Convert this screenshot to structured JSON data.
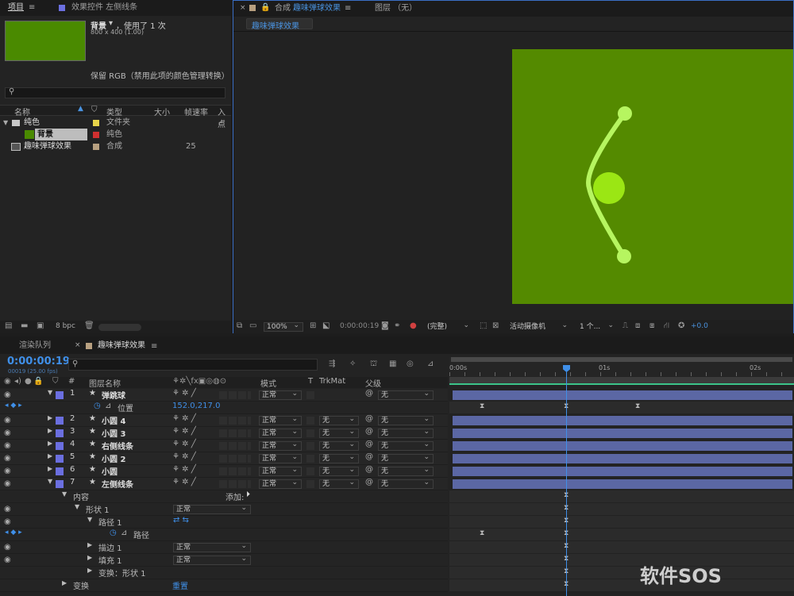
{
  "project_panel": {
    "tab_project": "项目",
    "tab_effects": "效果控件 左侧线条",
    "item_name": "背景",
    "item_usage": "，使用了 1 次",
    "item_dims": "800 x 400 (1.00)",
    "color_note": "保留 RGB（禁用此项的颜色管理转换）",
    "search_placeholder": "",
    "columns": [
      "名称",
      "类型",
      "大小",
      "帧速率",
      "入点"
    ],
    "rows": [
      {
        "name": "纯色",
        "type": "文件夹",
        "size": "",
        "fps": "",
        "color": "#e8d44a"
      },
      {
        "name": "背景",
        "type": "纯色",
        "size": "",
        "fps": "",
        "color": "#d03030"
      },
      {
        "name": "趣味弹球效果",
        "type": "合成",
        "size": "",
        "fps": "25",
        "color": "#b8a080"
      }
    ],
    "bpc": "8 bpc",
    "swatch_color": "#4a8a00"
  },
  "comp_panel": {
    "tab_comp_prefix": "合成",
    "tab_comp": "趣味弹球效果",
    "tab_layer": "图层 （无）",
    "comp_tab_label": "趣味弹球效果",
    "bg_color": "#548a00",
    "zoom": "100%",
    "timecode": "0:00:00:19",
    "quality": "(完整)",
    "camera": "活动摄像机",
    "views": "1 个...",
    "exposure": "+0.0"
  },
  "timeline": {
    "tab_render": "渲染队列",
    "tab_comp": "趣味弹球效果",
    "timecode": "0:00:00:19",
    "fps_info": "00019 (25.00 fps)",
    "col_hash": "#",
    "col_layer_name": "图层名称",
    "col_mode": "模式",
    "col_t": "T",
    "col_trkmat": "TrkMat",
    "col_parent": "父级",
    "ruler": [
      "0:00s",
      "01s",
      "02s"
    ],
    "layers": [
      {
        "num": "1",
        "name": "弹跳球",
        "mode": "正常",
        "trkmat": "",
        "parent": "无"
      },
      {
        "num": "2",
        "name": "小圆 4",
        "mode": "正常",
        "trkmat": "无",
        "parent": "无"
      },
      {
        "num": "3",
        "name": "小圆 3",
        "mode": "正常",
        "trkmat": "无",
        "parent": "无"
      },
      {
        "num": "4",
        "name": "右侧线条",
        "mode": "正常",
        "trkmat": "无",
        "parent": "无"
      },
      {
        "num": "5",
        "name": "小圆 2",
        "mode": "正常",
        "trkmat": "无",
        "parent": "无"
      },
      {
        "num": "6",
        "name": "小圆",
        "mode": "正常",
        "trkmat": "无",
        "parent": "无"
      },
      {
        "num": "7",
        "name": "左侧线条",
        "mode": "正常",
        "trkmat": "无",
        "parent": "无"
      }
    ],
    "position_label": "位置",
    "position_value": "152.0,217.0",
    "contents_label": "内容",
    "add_label": "添加:",
    "shape_label": "形状 1",
    "shape_mode": "正常",
    "path_group_label": "路径 1",
    "path_label": "路径",
    "stroke_label": "描边 1",
    "stroke_mode": "正常",
    "fill_label": "填充 1",
    "fill_mode": "正常",
    "transform_shape_label": "变换：形状 1",
    "transform_label": "变换",
    "reset_label": "重置"
  },
  "watermark": "软件SOS"
}
